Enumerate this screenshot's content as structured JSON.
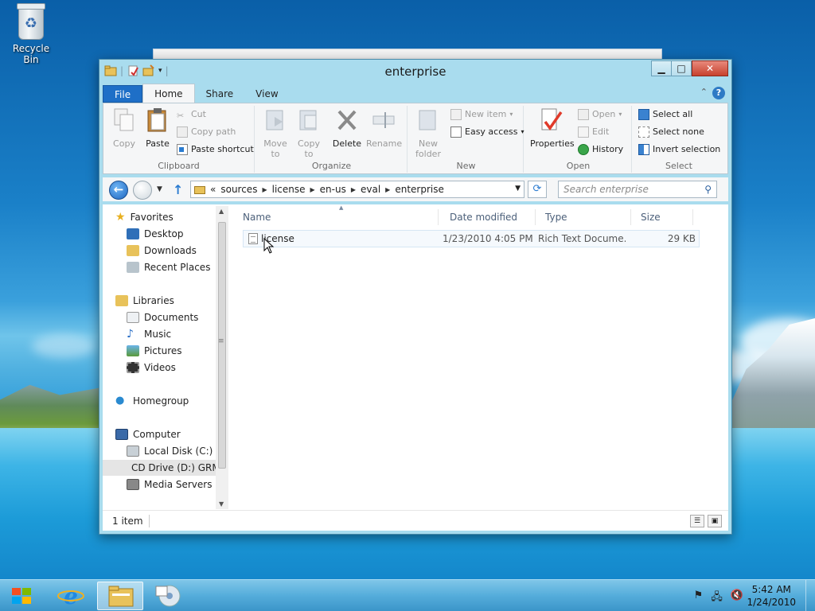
{
  "desktop": {
    "recycle_bin_label": "Recycle Bin"
  },
  "window": {
    "title": "enterprise",
    "help": "?"
  },
  "tabs": {
    "file": "File",
    "home": "Home",
    "share": "Share",
    "view": "View"
  },
  "ribbon": {
    "clipboard": {
      "label": "Clipboard",
      "copy": "Copy",
      "paste": "Paste",
      "cut": "Cut",
      "copy_path": "Copy path",
      "paste_shortcut": "Paste shortcut"
    },
    "organize": {
      "label": "Organize",
      "move_to": "Move to",
      "copy_to": "Copy to",
      "delete": "Delete",
      "rename": "Rename"
    },
    "new": {
      "label": "New",
      "new_folder": "New folder",
      "new_item": "New item",
      "easy_access": "Easy access"
    },
    "open": {
      "label": "Open",
      "properties": "Properties",
      "open": "Open",
      "edit": "Edit",
      "history": "History"
    },
    "select": {
      "label": "Select",
      "select_all": "Select all",
      "select_none": "Select none",
      "invert_selection": "Invert selection"
    }
  },
  "address": {
    "overflow": "«",
    "crumbs": [
      "sources",
      "license",
      "en-us",
      "eval",
      "enterprise"
    ],
    "search_placeholder": "Search enterprise"
  },
  "nav": {
    "favorites": "Favorites",
    "desktop": "Desktop",
    "downloads": "Downloads",
    "recent_places": "Recent Places",
    "libraries": "Libraries",
    "documents": "Documents",
    "music": "Music",
    "pictures": "Pictures",
    "videos": "Videos",
    "homegroup": "Homegroup",
    "computer": "Computer",
    "local_disk": "Local Disk (C:)",
    "cd_drive": "CD Drive (D:) GRM",
    "media_servers": "Media Servers"
  },
  "columns": {
    "name": "Name",
    "date_modified": "Date modified",
    "type": "Type",
    "size": "Size"
  },
  "files": [
    {
      "name": "license",
      "date_modified": "1/23/2010 4:05 PM",
      "type": "Rich Text Docume...",
      "size": "29 KB"
    }
  ],
  "status": {
    "count": "1 item"
  },
  "taskbar": {
    "time": "5:42 AM",
    "date": "1/24/2010"
  },
  "colors": {
    "window_frame": "#a9dcee",
    "file_tab": "#1e6fc7",
    "taskbar": "#55addb"
  }
}
